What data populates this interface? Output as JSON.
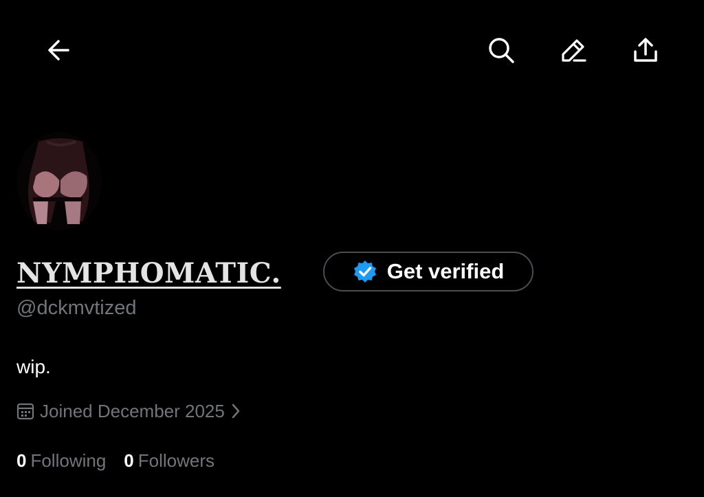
{
  "header": {
    "back_icon": "arrow-left-icon",
    "search_icon": "search-icon",
    "edit_icon": "pencil-icon",
    "share_icon": "share-upload-icon"
  },
  "profile": {
    "display_name": "NYMPHOMATIC.",
    "handle": "@dckmvtized",
    "bio": "wip.",
    "joined": "Joined December 2025",
    "verify_button": {
      "label": "Get verified",
      "icon": "verified-badge-icon",
      "badge_color": "#1d9bf0"
    },
    "stats": {
      "following_count": "0",
      "following_label": "Following",
      "followers_count": "0",
      "followers_label": "Followers"
    }
  },
  "colors": {
    "background": "#000000",
    "secondary_text": "#71767b",
    "primary_text": "#ffffff",
    "verified_blue": "#1d9bf0"
  }
}
